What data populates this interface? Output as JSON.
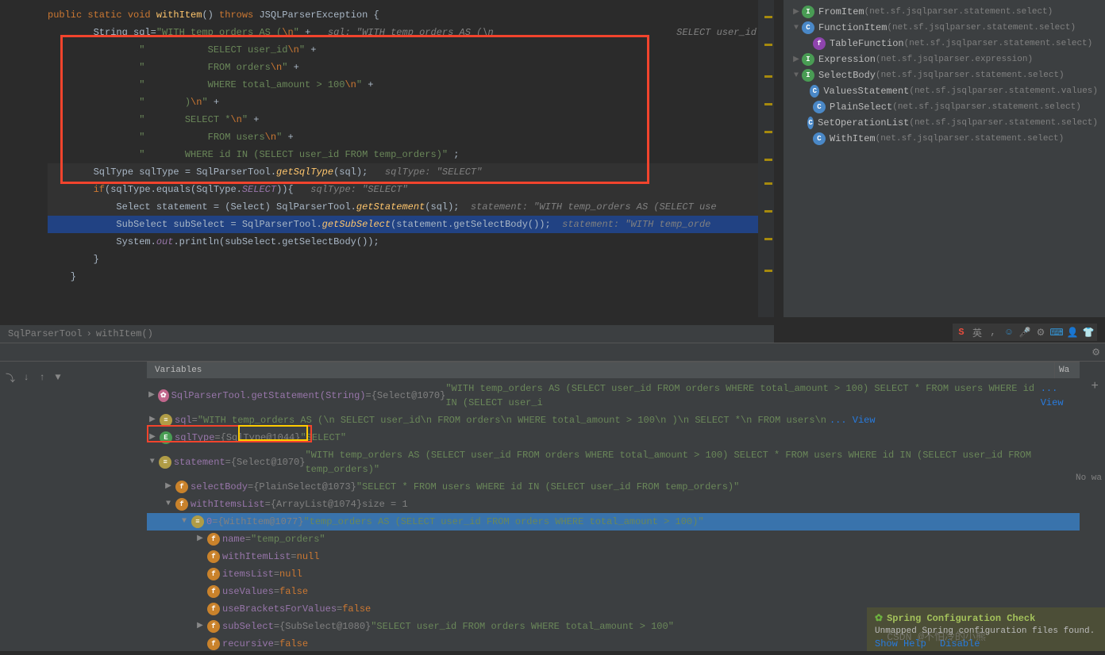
{
  "code": {
    "line1_pre": "    ",
    "line1_kw1": "public static void ",
    "line1_method": "withItem",
    "line1_post": "() ",
    "line1_kw2": "throws ",
    "line1_exc": "JSQLParserException ",
    "line1_brace": "{",
    "line2": "        String sql=",
    "line2_str": "\"WITH temp_orders AS (",
    "line2_esc": "\\n",
    "line2_str2": "\" ",
    "line2_op": "+",
    "line2_comment": "   sql: \"WITH temp_orders AS (\\n                                SELECT user_id\\n",
    "line3": "                ",
    "line3_str": "\"           SELECT user_id",
    "line3_esc": "\\n",
    "line3_str2": "\" ",
    "line3_op": "+",
    "line4": "                ",
    "line4_str": "\"           FROM orders",
    "line4_esc": "\\n",
    "line4_str2": "\" ",
    "line4_op": "+",
    "line5": "                ",
    "line5_str": "\"           WHERE total_amount > 100",
    "line5_esc": "\\n",
    "line5_str2": "\" ",
    "line5_op": "+",
    "line6": "                ",
    "line6_str": "\"       )",
    "line6_esc": "\\n",
    "line6_str2": "\" ",
    "line6_op": "+",
    "line7": "                ",
    "line7_str": "\"       SELECT *",
    "line7_esc": "\\n",
    "line7_str2": "\" ",
    "line7_op": "+",
    "line8": "                ",
    "line8_str": "\"           FROM users",
    "line8_esc": "\\n",
    "line8_str2": "\" ",
    "line8_op": "+",
    "line9": "                ",
    "line9_str": "\"       WHERE id IN (SELECT user_id FROM temp_orders)\"",
    "line9_op": " ;",
    "line10": "",
    "line11": "        SqlType sqlType = SqlParserTool.",
    "line11_m": "getSqlType",
    "line11_post": "(sql);",
    "line11_comment": "   sqlType: \"SELECT\"",
    "line12": "        ",
    "line12_kw": "if",
    "line12_post": "(sqlType.equals(SqlType.",
    "line12_f": "SELECT",
    "line12_post2": ")){",
    "line12_comment": "   sqlType: \"SELECT\"",
    "line13": "            Select statement = (Select) SqlParserTool.",
    "line13_m": "getStatement",
    "line13_post": "(sql);",
    "line13_comment": "  statement: \"WITH temp_orders AS (SELECT use",
    "line14": "            SubSelect subSelect = SqlParserTool.",
    "line14_m": "getSubSelect",
    "line14_post": "(statement.getSelectBody());",
    "line14_comment": "  statement: \"WITH temp_orde",
    "line15": "            System.",
    "line15_f": "out",
    "line15_post": ".println(subSelect.getSelectBody());",
    "line16": "        }",
    "line17": "    }"
  },
  "breadcrumb": {
    "item1": "SqlParserTool",
    "sep": "›",
    "item2": "withItem()"
  },
  "rightTree": {
    "items": [
      {
        "arrow": "▶",
        "iconClass": "icon-green",
        "iconText": "I",
        "label": "FromItem",
        "pkg": "(net.sf.jsqlparser.statement.select)",
        "indent": 0
      },
      {
        "arrow": "▼",
        "iconClass": "icon-blue",
        "iconText": "C",
        "label": "FunctionItem",
        "pkg": "(net.sf.jsqlparser.statement.select)",
        "indent": 0
      },
      {
        "arrow": "",
        "iconClass": "icon-purple",
        "iconText": "f",
        "label": "TableFunction",
        "pkg": "(net.sf.jsqlparser.statement.select)",
        "indent": 1
      },
      {
        "arrow": "▶",
        "iconClass": "icon-green",
        "iconText": "I",
        "label": "Expression",
        "pkg": "(net.sf.jsqlparser.expression)",
        "indent": 0
      },
      {
        "arrow": "▼",
        "iconClass": "icon-green",
        "iconText": "I",
        "label": "SelectBody",
        "pkg": "(net.sf.jsqlparser.statement.select)",
        "indent": 0
      },
      {
        "arrow": "",
        "iconClass": "icon-blue",
        "iconText": "C",
        "label": "ValuesStatement",
        "pkg": "(net.sf.jsqlparser.statement.values)",
        "indent": 1
      },
      {
        "arrow": "",
        "iconClass": "icon-blue",
        "iconText": "C",
        "label": "PlainSelect",
        "pkg": "(net.sf.jsqlparser.statement.select)",
        "indent": 1
      },
      {
        "arrow": "",
        "iconClass": "icon-blue",
        "iconText": "C",
        "label": "SetOperationList",
        "pkg": "(net.sf.jsqlparser.statement.select)",
        "indent": 1
      },
      {
        "arrow": "",
        "iconClass": "icon-blue",
        "iconText": "C",
        "label": "WithItem",
        "pkg": "(net.sf.jsqlparser.statement.select)",
        "indent": 1
      }
    ]
  },
  "debug": {
    "variablesTitle": "Variables",
    "waTitle": "Wa",
    "rows": [
      {
        "indent": 0,
        "arrow": "▶",
        "iconClass": "icon-pink",
        "iconText": "✿",
        "name": "SqlParserTool.getStatement(String)",
        "eq": " = ",
        "type": "{Select@1070}",
        "value": " \"WITH temp_orders AS (SELECT user_id FROM orders WHERE total_amount > 100) SELECT * FROM users WHERE id IN (SELECT user_i",
        "view": "... View"
      },
      {
        "indent": 0,
        "arrow": "▶",
        "iconClass": "icon-yellow",
        "iconText": "≡",
        "name": "sql",
        "eq": " = ",
        "type": "",
        "value": "\"WITH temp_orders AS (\\n           SELECT user_id\\n           FROM orders\\n           WHERE total_amount > 100\\n       )\\n       SELECT *\\n           FROM users\\n  ",
        "view": "... View"
      },
      {
        "indent": 0,
        "arrow": "▶",
        "iconClass": "icon-green",
        "iconText": "E",
        "name": "sqlType",
        "eq": " = ",
        "type": "{SqlType@1044}",
        "value": " \"SELECT\"",
        "view": ""
      },
      {
        "indent": 0,
        "arrow": "▼",
        "iconClass": "icon-yellow",
        "iconText": "≡",
        "name": "statement",
        "eq": " = ",
        "type": "{Select@1070}",
        "value": " \"WITH temp_orders AS (SELECT user_id FROM orders WHERE total_amount > 100) SELECT * FROM users WHERE id IN (SELECT user_id FROM temp_orders)\"",
        "view": ""
      },
      {
        "indent": 1,
        "arrow": "▶",
        "iconClass": "icon-orange",
        "iconText": "f",
        "name": "selectBody",
        "eq": " = ",
        "type": "{PlainSelect@1073}",
        "value": " \"SELECT * FROM users WHERE id IN (SELECT user_id FROM temp_orders)\"",
        "view": ""
      },
      {
        "indent": 1,
        "arrow": "▼",
        "iconClass": "icon-orange",
        "iconText": "f",
        "name": "withItemsList",
        "eq": " = ",
        "type": "{ArrayList@1074}",
        "value": "  size = 1",
        "view": ""
      },
      {
        "indent": 2,
        "arrow": "▼",
        "iconClass": "icon-yellow",
        "iconText": "≡",
        "name": "0",
        "eq": " = ",
        "type": "{WithItem@1077}",
        "value": " \"temp_orders AS (SELECT user_id FROM orders WHERE total_amount > 100)\"",
        "view": "",
        "current": true
      },
      {
        "indent": 3,
        "arrow": "▶",
        "iconClass": "icon-orange",
        "iconText": "f",
        "name": "name",
        "eq": " = ",
        "type": "",
        "value": "\"temp_orders\"",
        "view": ""
      },
      {
        "indent": 3,
        "arrow": "",
        "iconClass": "icon-orange",
        "iconText": "f",
        "name": "withItemList",
        "eq": " = ",
        "type": "",
        "value": "null",
        "view": ""
      },
      {
        "indent": 3,
        "arrow": "",
        "iconClass": "icon-orange",
        "iconText": "f",
        "name": "itemsList",
        "eq": " = ",
        "type": "",
        "value": "null",
        "view": ""
      },
      {
        "indent": 3,
        "arrow": "",
        "iconClass": "icon-orange",
        "iconText": "f",
        "name": "useValues",
        "eq": " = ",
        "type": "",
        "value": "false",
        "view": ""
      },
      {
        "indent": 3,
        "arrow": "",
        "iconClass": "icon-orange",
        "iconText": "f",
        "name": "useBracketsForValues",
        "eq": " = ",
        "type": "",
        "value": "false",
        "view": ""
      },
      {
        "indent": 3,
        "arrow": "▶",
        "iconClass": "icon-orange",
        "iconText": "f",
        "name": "subSelect",
        "eq": " = ",
        "type": "{SubSelect@1080}",
        "value": " \"SELECT user_id FROM orders WHERE total_amount > 100\"",
        "view": ""
      },
      {
        "indent": 3,
        "arrow": "",
        "iconClass": "icon-orange",
        "iconText": "f",
        "name": "recursive",
        "eq": " = ",
        "type": "",
        "value": "false",
        "view": ""
      }
    ],
    "noWa": "No wa"
  },
  "notification": {
    "title": "Spring Configuration Check",
    "body": "Unmapped Spring configuration files found.",
    "link1": "Show Help",
    "link2": "Disable"
  },
  "watermark": "CSDN @不怕冷的小熊",
  "floatBar": {
    "lang": "英"
  }
}
